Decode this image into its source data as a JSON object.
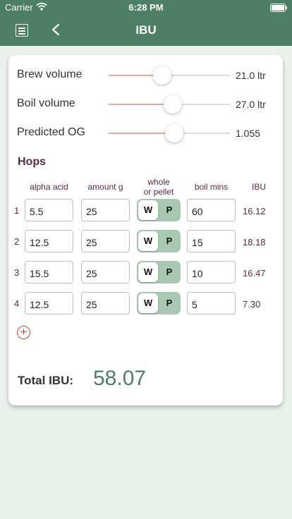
{
  "status_bar": {
    "carrier": "Carrier",
    "time": "6:28 PM"
  },
  "nav": {
    "title": "IBU",
    "menu_icon": "list-icon",
    "back_icon": "chevron-left-icon"
  },
  "sliders": [
    {
      "label": "Brew volume",
      "value": "21.0 ltr",
      "position": 0.44
    },
    {
      "label": "Boil volume",
      "value": "27.0 ltr",
      "position": 0.53
    },
    {
      "label": "Predicted OG",
      "value": "1.055",
      "position": 0.54
    }
  ],
  "hops": {
    "title": "Hops",
    "columns": {
      "alpha_acid": "alpha acid",
      "amount": "amount g",
      "form_line1": "whole",
      "form_line2": "or pellet",
      "boil": "boil mins",
      "ibu": "IBU"
    },
    "rows": [
      {
        "num": "1",
        "alpha": "5.5",
        "amount": "25",
        "whole": "W",
        "pellet": "P",
        "selected": "W",
        "boil": "60",
        "ibu": "16.12"
      },
      {
        "num": "2",
        "alpha": "12.5",
        "amount": "25",
        "whole": "W",
        "pellet": "P",
        "selected": "W",
        "boil": "15",
        "ibu": "18.18"
      },
      {
        "num": "3",
        "alpha": "15.5",
        "amount": "25",
        "whole": "W",
        "pellet": "P",
        "selected": "W",
        "boil": "10",
        "ibu": "16.47"
      },
      {
        "num": "4",
        "alpha": "12.5",
        "amount": "25",
        "whole": "W",
        "pellet": "P",
        "selected": "W",
        "boil": "5",
        "ibu": "7.30"
      }
    ],
    "add_icon": "plus-circle-icon"
  },
  "total": {
    "label": "Total IBU:",
    "value": "58.07"
  },
  "colors": {
    "header": "#4d7f66",
    "accent_text": "#5a2a45",
    "slider_fill": "#e5a9a0",
    "add_button": "#b94a3e",
    "total_value": "#4d7f66"
  }
}
